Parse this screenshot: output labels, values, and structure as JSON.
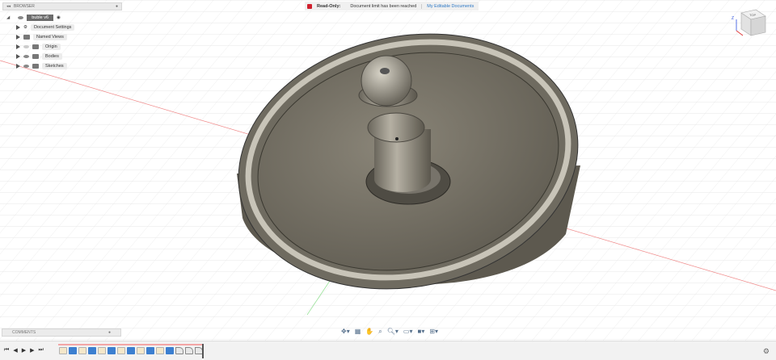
{
  "browser": {
    "title": "BROWSER",
    "root": "buble v6",
    "items": [
      {
        "label": "Document Settings",
        "icon": "gear-icon"
      },
      {
        "label": "Named Views",
        "icon": "folder-icon"
      },
      {
        "label": "Origin",
        "icon": "folder-icon"
      },
      {
        "label": "Bodies",
        "icon": "folder-icon"
      },
      {
        "label": "Sketches",
        "icon": "folder-icon"
      }
    ]
  },
  "status": {
    "readonly": "Read-Only:",
    "message": "Document limit has been reached",
    "link": "My Editable Documents",
    "accent": "#d0202e"
  },
  "viewcube": {
    "face": "TOP",
    "axis_z": "Z",
    "axis_x": "X"
  },
  "comments": {
    "title": "COMMENTS"
  },
  "navbar": {
    "icons": [
      "orbit-icon",
      "look-at-icon",
      "pan-icon",
      "zoom-window-icon",
      "zoom-icon",
      "display-settings-icon",
      "visual-style-icon",
      "grid-icon"
    ]
  },
  "timeline": {
    "features": [
      "sketch",
      "body",
      "sketch",
      "body",
      "sketch",
      "body",
      "sketch",
      "body",
      "sketch",
      "body",
      "sketch",
      "body",
      "fillet",
      "fillet",
      "fillet"
    ]
  }
}
